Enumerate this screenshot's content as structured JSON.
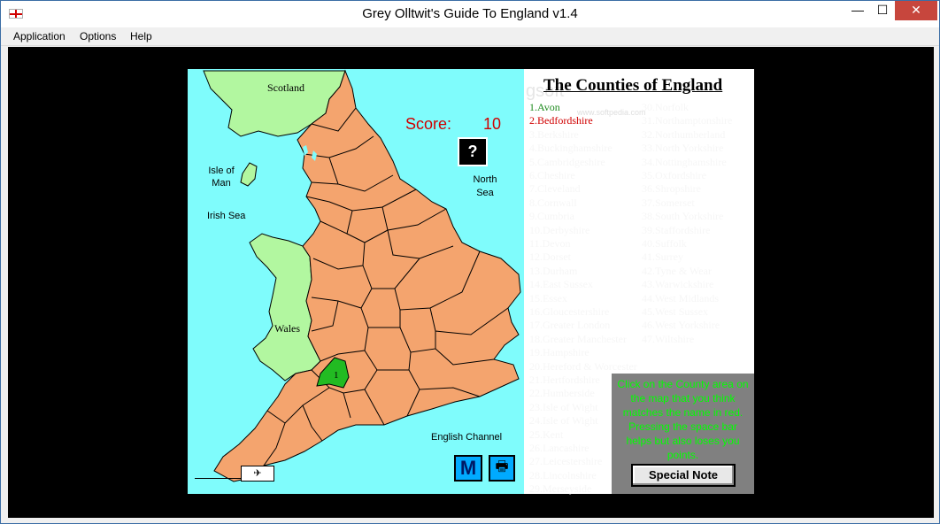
{
  "window": {
    "title": "Grey Olltwit's Guide To England v1.4",
    "minimize_glyph": "—",
    "maximize_glyph": "☐",
    "close_glyph": "✕"
  },
  "menu": {
    "application": "Application",
    "options": "Options",
    "help": "Help"
  },
  "map": {
    "labels": {
      "scotland": "Scotland",
      "isle_of_man": "Isle of Man",
      "irish_sea": "Irish Sea",
      "north_sea": "North Sea",
      "wales": "Wales",
      "english_channel": "English Channel"
    },
    "highlighted_county_number": "1",
    "score_label": "Score:",
    "score_value": "10",
    "help_button": "?",
    "map_button": "M",
    "print_icon": "printer-icon",
    "colors": {
      "sea": "#7ffcfc",
      "england": "#f4a46e",
      "neighbours": "#b2f7a0",
      "selected": "#22bb22"
    }
  },
  "list": {
    "title": "The Counties of England",
    "watermark": "gsoft",
    "watermark_url": "www.softpedia.com",
    "left_column": [
      "1.Avon",
      "2.Bedfordshire",
      "3.Berkshire",
      "4.Buckinghamshire",
      "5.Cambridgeshire",
      "6.Cheshire",
      "7.Cleveland",
      "8.Cornwall",
      "9.Cumbria",
      "10.Derbyshire",
      "11.Devon",
      "12.Dorset",
      "13.Durham",
      "14.East Sussex",
      "15.Essex",
      "16.Gloucestershire",
      "17.Greater London",
      "18.Greater Manchester",
      "19.Hampshire",
      "20.Hereford & Worcester",
      "21.Hertfordshire",
      "22.Humberside",
      "23.Isle of Wight",
      "24.Isle of Wight",
      "25.Kent",
      "26.Lancashire",
      "27.Leicestershire",
      "28.Lincolnshire",
      "29.Merseyside"
    ],
    "right_column": [
      "30.Norfolk",
      "31.Northamptonshire",
      "32.Northumberland",
      "33.North Yorkshire",
      "34.Nottinghamshire",
      "35.Oxfordshire",
      "36.Shropshire",
      "37.Somerset",
      "38.South Yorkshire",
      "39.Staffordshire",
      "40.Suffolk",
      "41.Surrey",
      "42.Tyne & Wear",
      "43.Warwickshire",
      "44.West Midlands",
      "45.West Sussex",
      "46.West Yorkshire",
      "47.Wiltshire"
    ],
    "done_count": 1,
    "current_index": 1
  },
  "instructions": {
    "text": "Click on the County area on the map that you think matches the name in red. Pressing the space bar helps but also loses you points.",
    "button_label": "Special Note"
  }
}
